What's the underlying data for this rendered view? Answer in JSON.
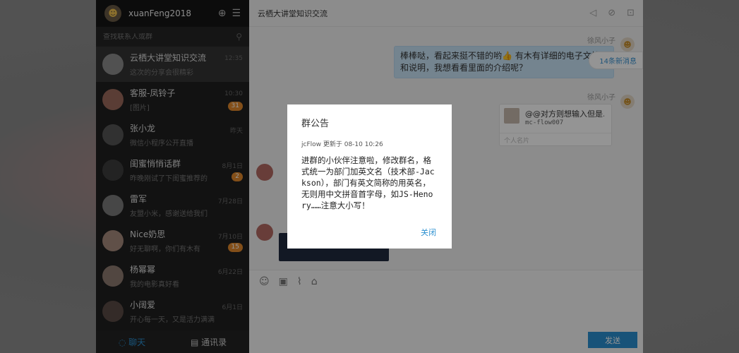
{
  "user": {
    "name": "xuanFeng2018"
  },
  "search": {
    "placeholder": "查找联系人或群"
  },
  "conversations": [
    {
      "name": "云栖大讲堂知识交流",
      "preview": "这次的分享会很精彩",
      "time": "12:35",
      "badge": ""
    },
    {
      "name": "客服-凤铃子",
      "preview": "[图片]",
      "time": "10:30",
      "badge": "31"
    },
    {
      "name": "张小龙",
      "preview": "微信小程序公开直播",
      "time": "昨天",
      "badge": ""
    },
    {
      "name": "闺蜜悄悄话群",
      "preview": "昨晚刚试了下闺蜜推荐的",
      "time": "8月1日",
      "badge": "2"
    },
    {
      "name": "雷军",
      "preview": "友盟小米，感谢送给我们",
      "time": "7月28日",
      "badge": ""
    },
    {
      "name": "Nice奶思",
      "preview": "好无聊啊，你们有木有",
      "time": "7月10日",
      "badge": "15"
    },
    {
      "name": "杨幂幂",
      "preview": "我的电影真好看",
      "time": "6月22日",
      "badge": ""
    },
    {
      "name": "小阔爱",
      "preview": "开心每一天，又是活力满满",
      "time": "6月1日",
      "badge": ""
    }
  ],
  "tabs": {
    "chat": "聊天",
    "contacts": "通讯录"
  },
  "chat": {
    "title": "云栖大讲堂知识交流",
    "nick1": "徐风小子",
    "msg1": "棒棒哒，看起来挺不错的哟👍 有木有详细的电子文档和说明，我想看看里面的介绍呢？",
    "new_messages": "14条新消息",
    "nick2": "徐风小子",
    "card_title": "@@对方则想输入但是…",
    "card_id": "mc-flow007",
    "card_footer": "个人名片",
    "send": "发送"
  },
  "modal": {
    "title": "群公告",
    "meta": "jcFlow 更新于 08-10 10:26",
    "body": "进群的小伙伴注意啦，修改群名，格式统一为部门加英文名（技术部-Jackson），部门有英文简称的用英名，无则用中文拼音首字母，如JS-Henory……注意大小写！",
    "close": "关闭"
  },
  "colors": {
    "accent": "#2a8fd0",
    "badge": "#e2892b",
    "sidebar": "#1f1f1f",
    "bubble": "#c9e4f6"
  }
}
